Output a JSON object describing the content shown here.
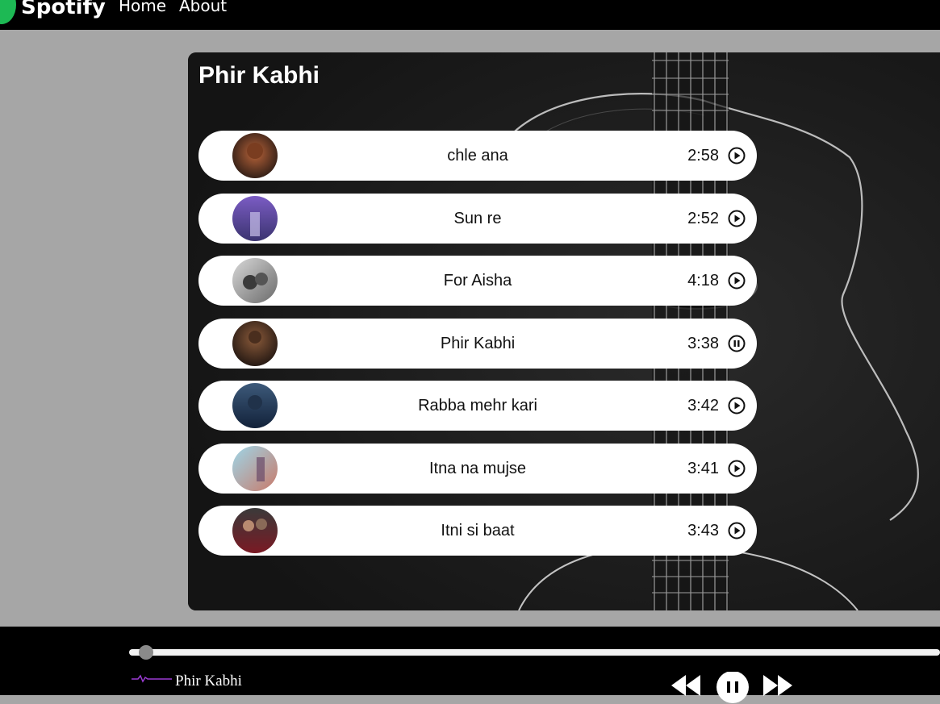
{
  "nav": {
    "logo_text": "Spotify",
    "links": [
      "Home",
      "About"
    ]
  },
  "playlist": {
    "title": "Phir Kabhi",
    "songs": [
      {
        "name": "chle ana",
        "duration": "2:58",
        "state": "play"
      },
      {
        "name": "Sun re",
        "duration": "2:52",
        "state": "play"
      },
      {
        "name": "For Aisha",
        "duration": "4:18",
        "state": "play"
      },
      {
        "name": "Phir Kabhi",
        "duration": "3:38",
        "state": "pause"
      },
      {
        "name": "Rabba mehr kari",
        "duration": "3:42",
        "state": "play"
      },
      {
        "name": "Itna na mujse",
        "duration": "3:41",
        "state": "play"
      },
      {
        "name": "Itni si baat",
        "duration": "3:43",
        "state": "play"
      }
    ]
  },
  "player": {
    "now_playing": "Phir Kabhi",
    "progress": 0.02,
    "is_playing": true
  },
  "colors": {
    "brand": "#1db954",
    "nav_bg": "#000000",
    "page_bg": "#a6a6a6",
    "card_bg": "#1f1f1f"
  }
}
